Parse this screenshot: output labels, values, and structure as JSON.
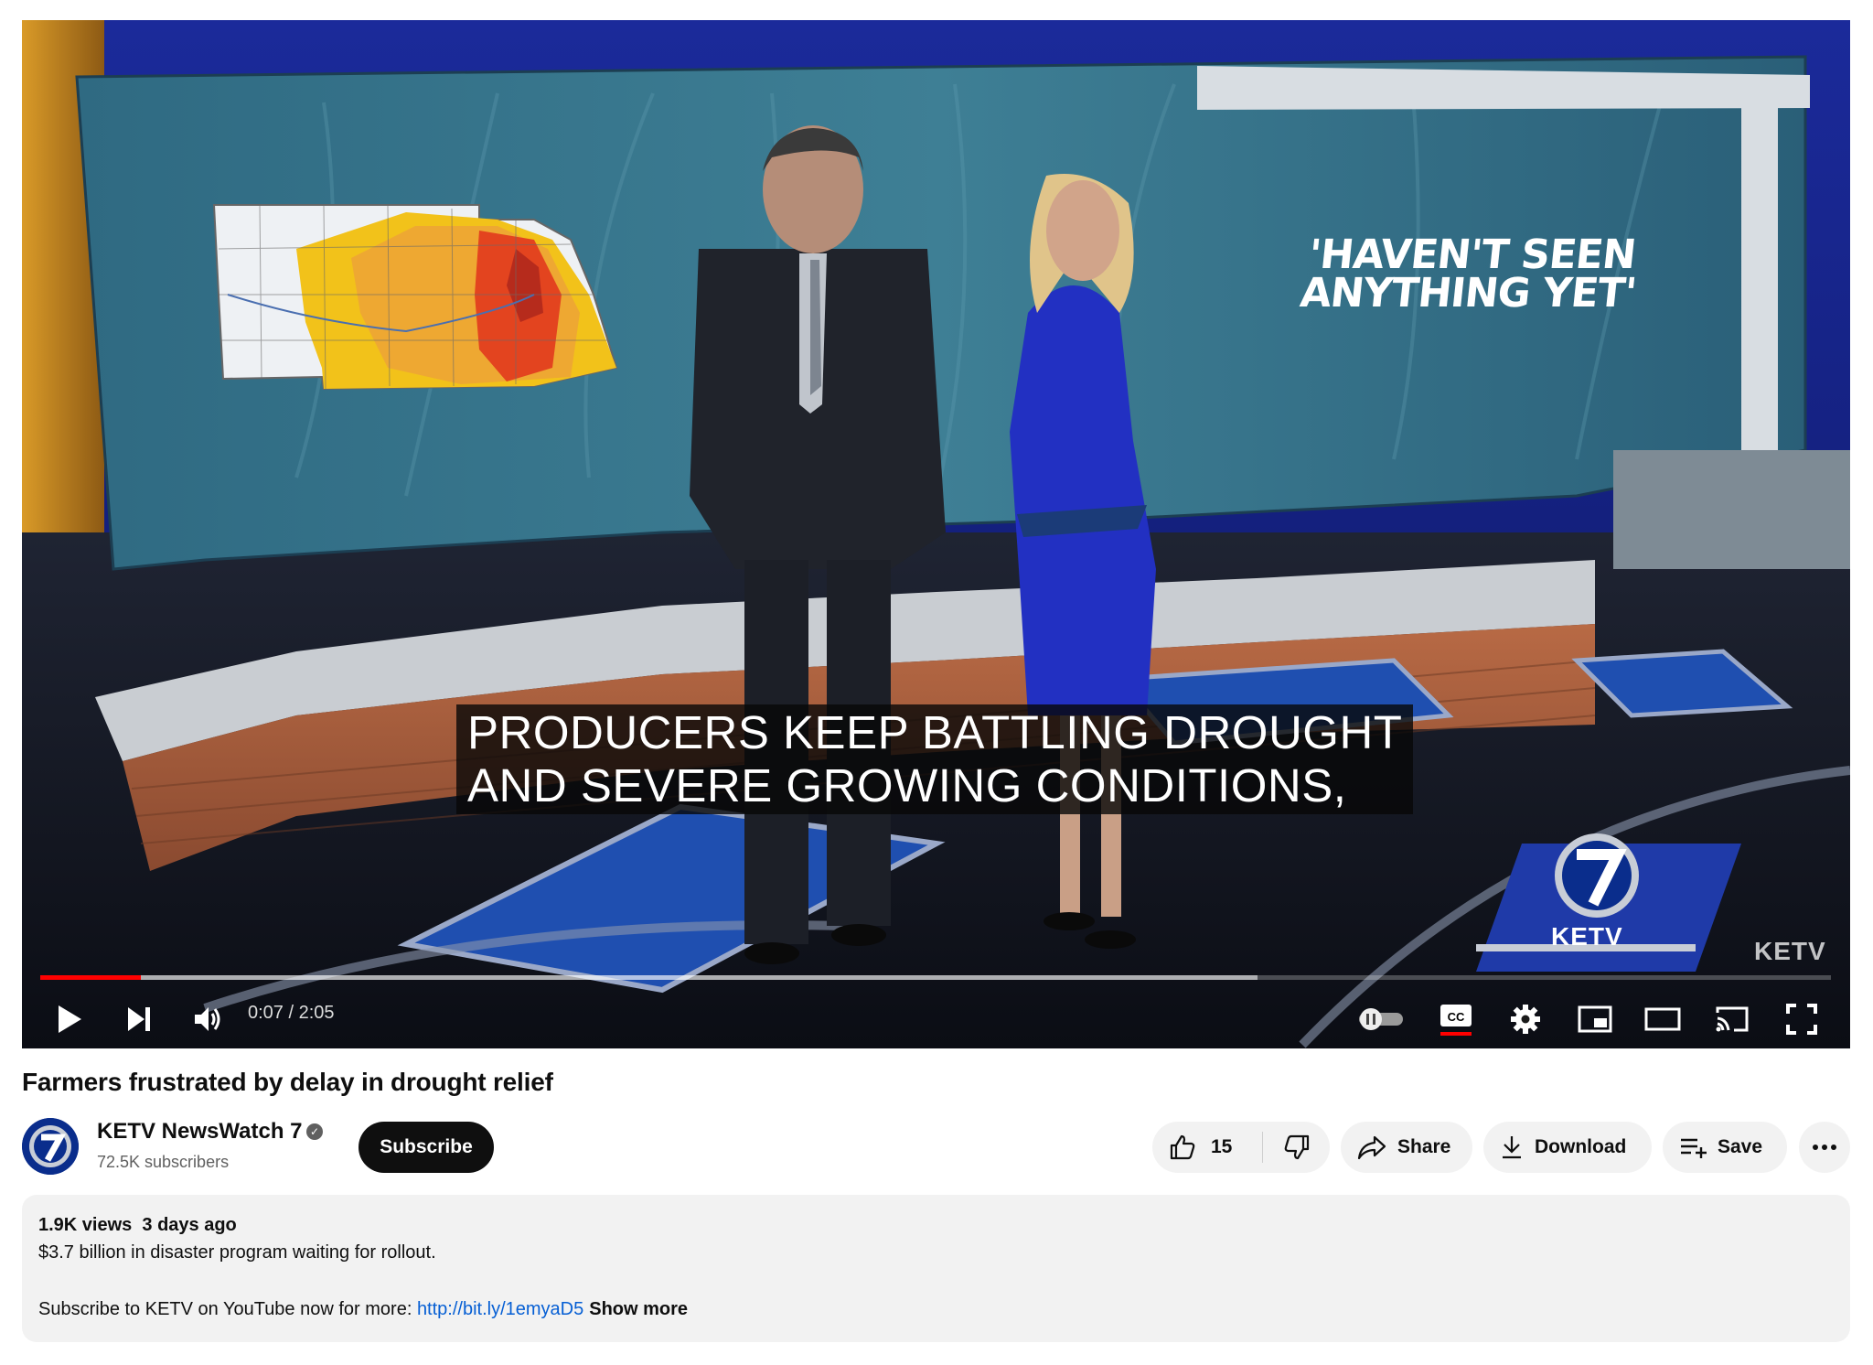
{
  "player": {
    "caption_line1": "PRODUCERS KEEP BATTLING DROUGHT",
    "caption_line2": "AND SEVERE GROWING CONDITIONS,",
    "graphic_line1": "'HAVEN'T SEEN",
    "graphic_line2": "ANYTHING YET'",
    "station_logo": "KETV",
    "watermark": "KETV",
    "time_display": "0:07 / 2:05",
    "progress_fraction": 0.056,
    "buffered_fraction": 0.68,
    "accent_color": "#ff0000"
  },
  "video": {
    "title": "Farmers frustrated by delay in drought relief"
  },
  "channel": {
    "name": "KETV NewsWatch 7",
    "subscribers": "72.5K subscribers",
    "subscribe_label": "Subscribe",
    "verified_icon": "verified-check-icon"
  },
  "actions": {
    "like_count": "15",
    "share_label": "Share",
    "download_label": "Download",
    "save_label": "Save"
  },
  "description": {
    "meta": "1.9K views  3 days ago",
    "line1": "$3.7 billion in disaster program waiting for rollout.",
    "line2_prefix": "Subscribe to KETV on YouTube now for more: ",
    "link": "http://bit.ly/1emyaD5",
    "show_more": "Show more"
  }
}
